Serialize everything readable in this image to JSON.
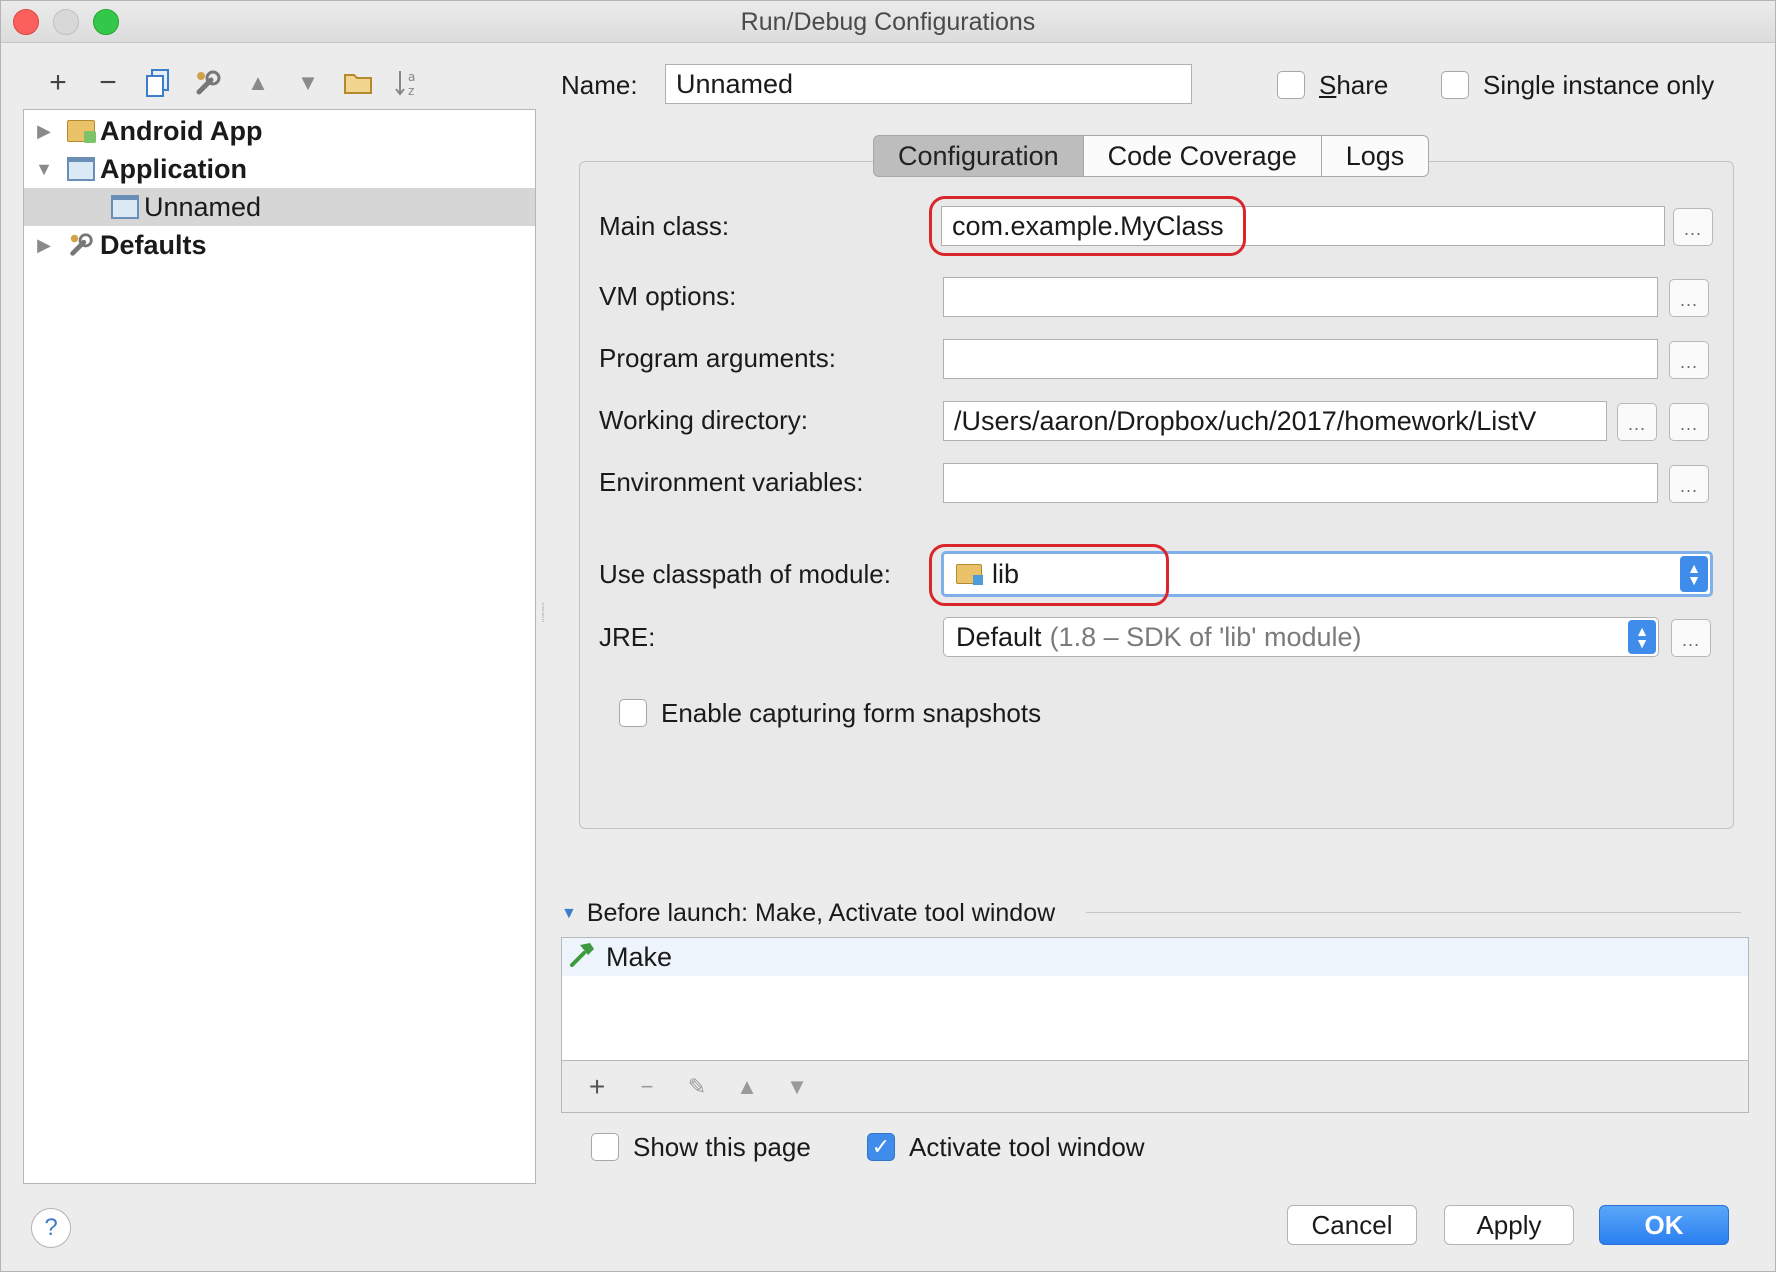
{
  "window": {
    "title": "Run/Debug Configurations"
  },
  "left_toolbar": {
    "add": "+",
    "remove": "−",
    "copy_icon": "copy-icon",
    "edit_defaults_icon": "wrench-icon",
    "move_up": "▲",
    "move_down": "▼",
    "folder_icon": "folder-icon",
    "sort_icon": "sort-az-icon"
  },
  "tree": {
    "items": [
      {
        "label": "Android App",
        "arrow": "▶",
        "icon": "android-folder-icon"
      },
      {
        "label": "Application",
        "arrow": "▼",
        "icon": "application-icon"
      },
      {
        "label": "Unnamed",
        "arrow": "",
        "icon": "application-icon"
      },
      {
        "label": "Defaults",
        "arrow": "▶",
        "icon": "wrench-icon"
      }
    ]
  },
  "header": {
    "name_label": "Name:",
    "name_value": "Unnamed",
    "share_label": "Share",
    "single_instance_label": "Single instance only"
  },
  "tabs": [
    {
      "label": "Configuration"
    },
    {
      "label": "Code Coverage"
    },
    {
      "label": "Logs"
    }
  ],
  "form": {
    "main_class_label": "Main class:",
    "main_class_value": "com.example.MyClass",
    "vm_options_label": "VM options:",
    "vm_options_value": "",
    "program_arguments_label": "Program arguments:",
    "program_arguments_value": "",
    "working_directory_label": "Working directory:",
    "working_directory_value": "/Users/aaron/Dropbox/uch/2017/homework/ListV",
    "environment_variables_label": "Environment variables:",
    "environment_variables_value": "",
    "classpath_label": "Use classpath of module:",
    "classpath_value": "lib",
    "jre_label": "JRE:",
    "jre_value": "Default",
    "jre_detail": "(1.8 – SDK of 'lib' module)",
    "snapshots_label": "Enable capturing form snapshots",
    "ellipsis": "..."
  },
  "before_launch": {
    "title": "Before launch: Make, Activate tool window",
    "items": [
      {
        "label": "Make",
        "icon": "hammer-icon"
      }
    ],
    "tools": {
      "add": "+",
      "remove": "−",
      "edit": "✎",
      "up": "▲",
      "down": "▼"
    }
  },
  "options": {
    "show_page_label": "Show this page",
    "show_page_checked": false,
    "activate_tool_label": "Activate tool window",
    "activate_tool_checked": true
  },
  "buttons": {
    "help": "?",
    "cancel": "Cancel",
    "apply": "Apply",
    "ok": "OK"
  },
  "colors": {
    "accent": "#3f8ceb",
    "highlight": "#d8262b"
  }
}
